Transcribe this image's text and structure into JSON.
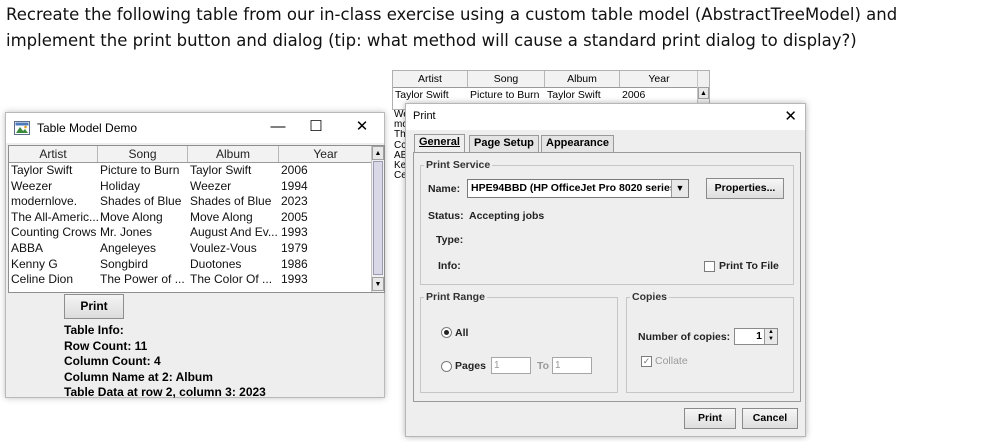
{
  "instructions": "Recreate the following table from our in-class exercise using a custom table model (AbstractTreeModel) and implement the print button and dialog (tip: what method will cause a standard print dialog to display?)",
  "demo_window": {
    "title": "Table Model Demo",
    "minimize": "—",
    "maximize": "☐",
    "close": "✕",
    "columns": [
      "Artist",
      "Song",
      "Album",
      "Year"
    ],
    "rows": [
      [
        "Taylor Swift",
        "Picture to Burn",
        "Taylor Swift",
        "2006"
      ],
      [
        "Weezer",
        "Holiday",
        "Weezer",
        "1994"
      ],
      [
        "modernlove.",
        "Shades of Blue",
        "Shades of Blue",
        "2023"
      ],
      [
        "The All-Americ...",
        "Move Along",
        "Move Along",
        "2005"
      ],
      [
        "Counting Crows",
        "Mr. Jones",
        "August And Ev...",
        "1993"
      ],
      [
        "ABBA",
        "Angeleyes",
        "Voulez-Vous",
        "1979"
      ],
      [
        "Kenny G",
        "Songbird",
        "Duotones",
        "1986"
      ],
      [
        "Celine Dion",
        "The Power of ...",
        "The Color Of ...",
        "1993"
      ]
    ],
    "print_button": "Print",
    "info_heading": "Table Info:",
    "row_count": "Row Count: 11",
    "column_count": "Column Count: 4",
    "column_name": "Column Name at 2: Album",
    "table_data": "Table Data at row 2, column 3: 2023"
  },
  "background_table": {
    "columns": [
      "Artist",
      "Song",
      "Album",
      "Year"
    ],
    "row": [
      "Taylor Swift",
      "Picture to Burn",
      "Taylor Swift",
      "2006"
    ],
    "clipped_rows": [
      "We",
      "mc",
      "Th",
      "Cc",
      "AB",
      "Ke",
      "Ce"
    ]
  },
  "print_dialog": {
    "title": "Print",
    "close": "✕",
    "tabs": [
      "General",
      "Page Setup",
      "Appearance"
    ],
    "print_service_label": "Print Service",
    "name_label": "Name:",
    "printer_name": "HPE94BBD (HP OfficeJet Pro 8020 series)",
    "properties_button": "Properties...",
    "status_label": "Status:",
    "status_value": "Accepting jobs",
    "type_label": "Type:",
    "info_label": "Info:",
    "print_to_file": "Print To File",
    "print_range_label": "Print Range",
    "all_label": "All",
    "pages_label": "Pages",
    "pages_from": "1",
    "to_label": "To",
    "pages_to": "1",
    "copies_label": "Copies",
    "number_of_copies_label": "Number of copies:",
    "copies_value": "1",
    "collate_label": "Collate",
    "print_button": "Print",
    "cancel_button": "Cancel"
  }
}
